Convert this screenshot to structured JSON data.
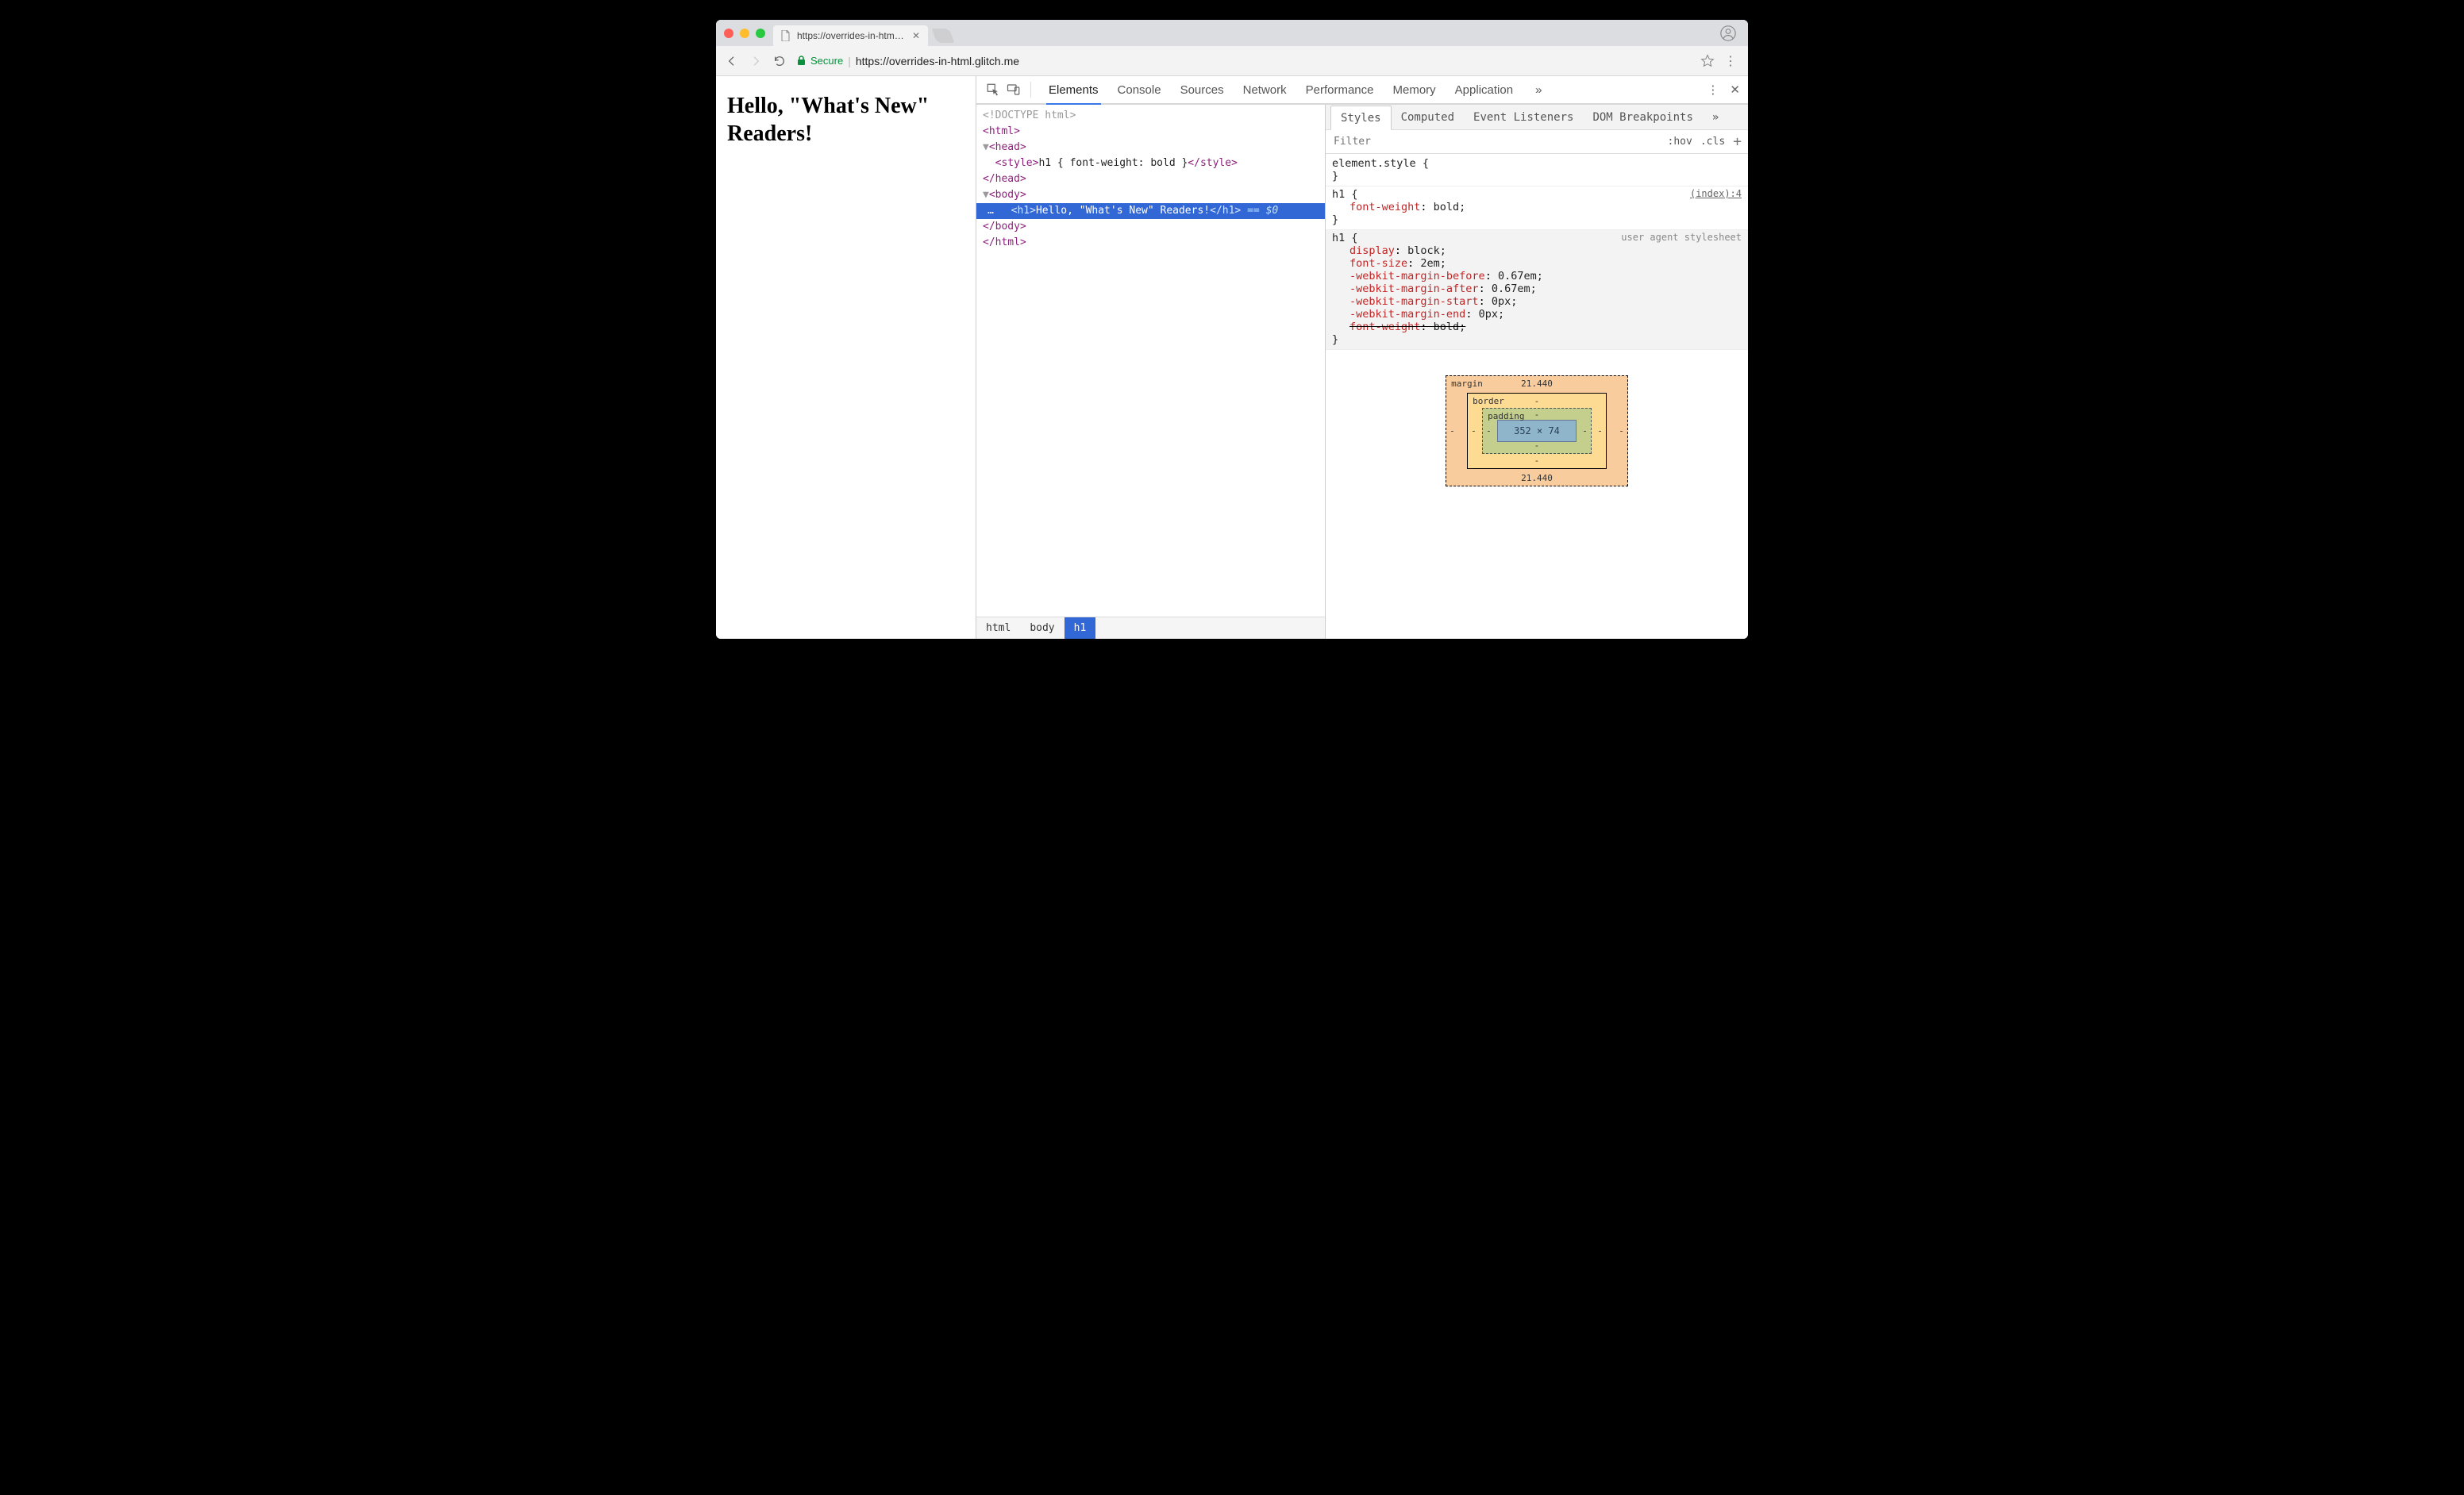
{
  "browser": {
    "tab_title": "https://overrides-in-html.glitch…",
    "secure_label": "Secure",
    "url_host": "https://overrides-in-html.glitch.me",
    "url_path": ""
  },
  "page": {
    "heading": "Hello, \"What's New\" Readers!"
  },
  "devtools": {
    "tabs": [
      "Elements",
      "Console",
      "Sources",
      "Network",
      "Performance",
      "Memory",
      "Application"
    ],
    "active_tab": "Elements",
    "more_glyph": "»"
  },
  "elements": {
    "tree": {
      "doctype": "<!DOCTYPE html>",
      "html_open": "html",
      "head_open": "head",
      "style_text": "h1 { font-weight: bold }",
      "body_open": "body",
      "h1_text": "Hello, \"What's New\" Readers!",
      "selected_meta": "== $0"
    },
    "crumbs": [
      "html",
      "body",
      "h1"
    ]
  },
  "styles": {
    "tabs": [
      "Styles",
      "Computed",
      "Event Listeners",
      "DOM Breakpoints"
    ],
    "more_glyph": "»",
    "filter_placeholder": "Filter",
    "hov_label": ":hov",
    "cls_label": ".cls",
    "rules": {
      "element_style_selector": "element.style",
      "h1_rule": {
        "selector": "h1",
        "source": "(index):4",
        "decls": [
          {
            "prop": "font-weight",
            "val": "bold"
          }
        ]
      },
      "ua_rule": {
        "selector": "h1",
        "source": "user agent stylesheet",
        "decls": [
          {
            "prop": "display",
            "val": "block"
          },
          {
            "prop": "font-size",
            "val": "2em"
          },
          {
            "prop": "-webkit-margin-before",
            "val": "0.67em"
          },
          {
            "prop": "-webkit-margin-after",
            "val": "0.67em"
          },
          {
            "prop": "-webkit-margin-start",
            "val": "0px"
          },
          {
            "prop": "-webkit-margin-end",
            "val": "0px"
          },
          {
            "prop": "font-weight",
            "val": "bold",
            "struck": true
          }
        ]
      }
    },
    "boxmodel": {
      "margin_label": "margin",
      "margin_top": "21.440",
      "margin_bottom": "21.440",
      "margin_left": "-",
      "margin_right": "-",
      "border_label": "border",
      "border_v": "-",
      "padding_label": "padding",
      "padding_v": "-",
      "content": "352 × 74"
    }
  }
}
